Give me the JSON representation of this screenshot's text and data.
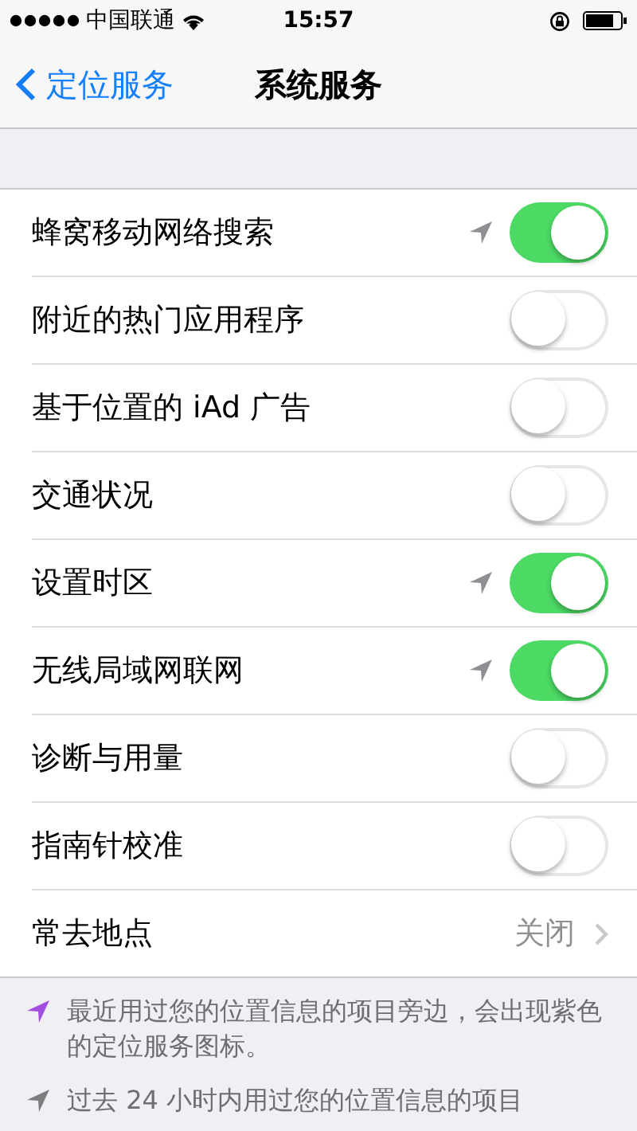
{
  "status_bar": {
    "carrier": "中国联通",
    "time": "15:57"
  },
  "nav": {
    "back": "定位服务",
    "title": "系统服务"
  },
  "rows": [
    {
      "kind": "toggle",
      "label": "蜂窝移动网络搜索",
      "on": true,
      "location": true
    },
    {
      "kind": "toggle",
      "label": "附近的热门应用程序",
      "on": false,
      "location": false
    },
    {
      "kind": "toggle",
      "label": "基于位置的 iAd 广告",
      "on": false,
      "location": false
    },
    {
      "kind": "toggle",
      "label": "交通状况",
      "on": false,
      "location": false
    },
    {
      "kind": "toggle",
      "label": "设置时区",
      "on": true,
      "location": true
    },
    {
      "kind": "toggle",
      "label": "无线局域网联网",
      "on": true,
      "location": true
    },
    {
      "kind": "toggle",
      "label": "诊断与用量",
      "on": false,
      "location": false
    },
    {
      "kind": "toggle",
      "label": "指南针校准",
      "on": false,
      "location": false
    },
    {
      "kind": "detail",
      "label": "常去地点",
      "value": "关闭"
    }
  ],
  "notes": [
    {
      "color": "#a24fe0",
      "text": "最近用过您的位置信息的项目旁边，会出现紫色的定位服务图标。"
    },
    {
      "color": "#7d7d80",
      "text": "过去 24 小时内用过您的位置信息的项目"
    }
  ]
}
